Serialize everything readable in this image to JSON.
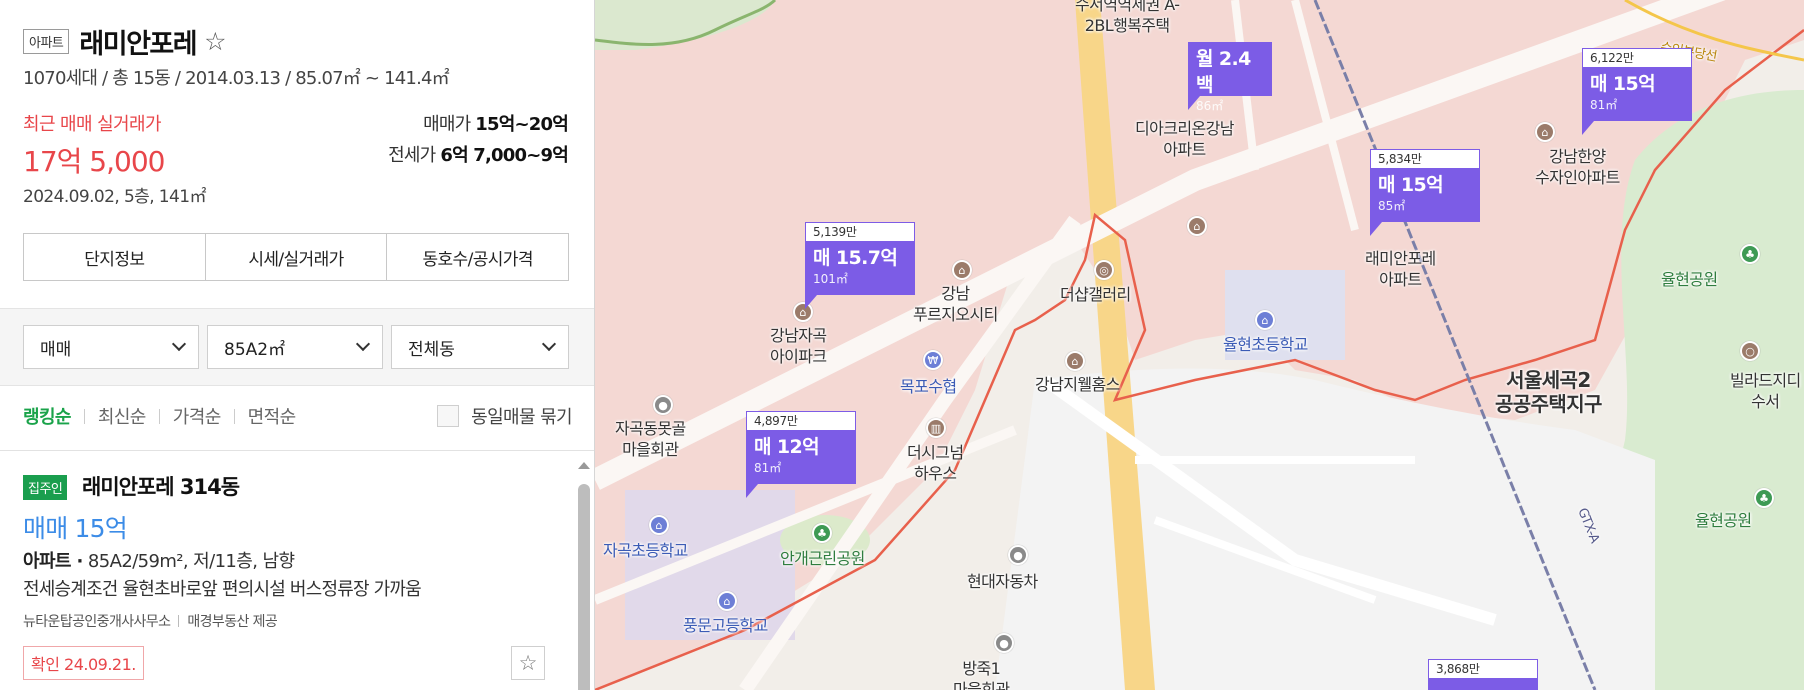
{
  "panel": {
    "type_badge": "아파트",
    "title": "래미안포레",
    "star": "☆",
    "info": "1070세대 / 총 15동 / 2014.03.13 / 85.07㎡ ~ 141.4㎡",
    "recent_label": "최근 매매 실거래가",
    "recent_price": "17억 5,000",
    "recent_detail": "2024.09.02, 5층, 141㎡",
    "sale_range_label": "매매가",
    "sale_range": "15억~20억",
    "jeonse_range_label": "전세가",
    "jeonse_range": "6억 7,000~9억",
    "tabs": [
      "단지정보",
      "시세/실거래가",
      "동호수/공시가격"
    ],
    "filters": [
      "매매",
      "85A2㎡",
      "전체동"
    ],
    "sorts": [
      "랭킹순",
      "최신순",
      "가격순",
      "면적순"
    ],
    "group_label": "동일매물 묶기"
  },
  "listing": {
    "badge": "집주인",
    "title": "래미안포레 314동",
    "price": "매매 15억",
    "spec_bold": "아파트 ·",
    "spec": " 85A2/59m², 저/11층, 남향",
    "desc": "전세승계조건 율현초바로앞 편의시설 버스정류장 가까움",
    "agent": "뉴타운탑공인중개사사무소",
    "provider": "매경부동산 제공",
    "confirm": "확인 24.09.21.",
    "star": "☆"
  },
  "map": {
    "labels": [
      {
        "text": "수서역역세권 A-\n2BL행복주택",
        "cls": ""
      },
      {
        "text": "디아크리온강남\n아파트",
        "cls": ""
      },
      {
        "text": "강남한양\n수자인아파트",
        "cls": ""
      },
      {
        "text": "래미안포레\n아파트",
        "cls": ""
      },
      {
        "text": "강남\n푸르지오시티",
        "cls": ""
      },
      {
        "text": "더샵갤러리",
        "cls": ""
      },
      {
        "text": "강남자곡\n아이파크",
        "cls": ""
      },
      {
        "text": "목포수협",
        "cls": "blue"
      },
      {
        "text": "강남지웰홈스",
        "cls": ""
      },
      {
        "text": "율현초등학교",
        "cls": "blue"
      },
      {
        "text": "율현공원",
        "cls": "green"
      },
      {
        "text": "율현공원",
        "cls": "green"
      },
      {
        "text": "서울세곡2\n공공주택지구",
        "cls": "big"
      },
      {
        "text": "빌라드지디\n수서",
        "cls": ""
      },
      {
        "text": "자곡동못골\n마을회관",
        "cls": ""
      },
      {
        "text": "더시그넘\n하우스",
        "cls": ""
      },
      {
        "text": "자곡초등학교",
        "cls": "blue"
      },
      {
        "text": "안개근린공원",
        "cls": "green"
      },
      {
        "text": "풍문고등학교",
        "cls": "blue"
      },
      {
        "text": "현대자동차",
        "cls": ""
      },
      {
        "text": "방죽1\n마을회관",
        "cls": ""
      },
      {
        "text": "수인분당선",
        "cls": "rail"
      },
      {
        "text": "GTX-A",
        "cls": "rail"
      }
    ],
    "markers": [
      {
        "unit": "",
        "price": "월 2.4백",
        "area": "86㎡"
      },
      {
        "unit": "6,122만",
        "price": "매 15억",
        "area": "81㎡"
      },
      {
        "unit": "5,834만",
        "price": "매 15억",
        "area": "85㎡"
      },
      {
        "unit": "5,139만",
        "price": "매 15.7억",
        "area": "101㎡"
      },
      {
        "unit": "4,897만",
        "price": "매 12억",
        "area": "81㎡"
      },
      {
        "unit": "3,868만",
        "price": "",
        "area": ""
      }
    ]
  },
  "colors": {
    "accent_red": "#e8464a",
    "accent_green": "#1aa34a",
    "listing_blue": "#3c8ce7",
    "marker_purple": "#7c5ce6"
  }
}
